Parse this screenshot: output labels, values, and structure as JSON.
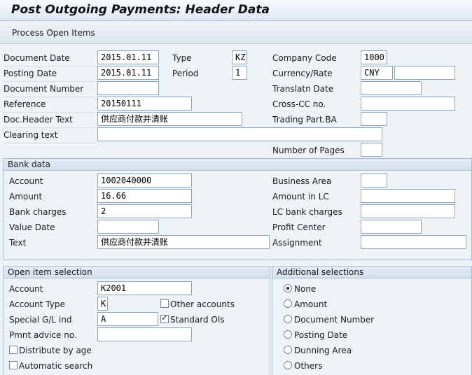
{
  "title": "Post Outgoing Payments: Header Data",
  "toolbar": {
    "process_open_items": "Process Open Items"
  },
  "header": {
    "document_date": {
      "label": "Document Date",
      "value": "2015.01.11"
    },
    "type": {
      "label": "Type",
      "value": "KZ"
    },
    "company_code": {
      "label": "Company Code",
      "value": "1000"
    },
    "posting_date": {
      "label": "Posting Date",
      "value": "2015.01.11"
    },
    "period": {
      "label": "Period",
      "value": "1"
    },
    "currency_rate": {
      "label": "Currency/Rate",
      "currency": "CNY",
      "rate": ""
    },
    "document_number": {
      "label": "Document Number",
      "value": ""
    },
    "translatn_date": {
      "label": "Translatn Date",
      "value": ""
    },
    "reference": {
      "label": "Reference",
      "value": "20150111"
    },
    "cross_cc": {
      "label": "Cross-CC no.",
      "value": ""
    },
    "doc_header_text": {
      "label": "Doc.Header Text",
      "value": "供应商付款并清账"
    },
    "trading_part": {
      "label": "Trading Part.BA",
      "value": ""
    },
    "clearing_text": {
      "label": "Clearing text",
      "value": ""
    },
    "number_of_pages": {
      "label": "Number of Pages",
      "value": ""
    }
  },
  "bank": {
    "title": "Bank data",
    "account": {
      "label": "Account",
      "value": "1002040000"
    },
    "business_area": {
      "label": "Business Area",
      "value": ""
    },
    "amount": {
      "label": "Amount",
      "value": "16.66"
    },
    "amount_lc": {
      "label": "Amount in LC",
      "value": ""
    },
    "bank_charges": {
      "label": "Bank charges",
      "value": "2"
    },
    "lc_bank_charges": {
      "label": "LC bank charges",
      "value": ""
    },
    "value_date": {
      "label": "Value Date",
      "value": ""
    },
    "profit_center": {
      "label": "Profit Center",
      "value": ""
    },
    "text": {
      "label": "Text",
      "value": "供应商付款并清账"
    },
    "assignment": {
      "label": "Assignment",
      "value": ""
    }
  },
  "open_items": {
    "title": "Open item selection",
    "account": {
      "label": "Account",
      "value": "K2001"
    },
    "account_type": {
      "label": "Account Type",
      "value": "K"
    },
    "other_accounts": {
      "label": "Other accounts",
      "checked": false
    },
    "special_gl": {
      "label": "Special G/L ind",
      "value": "A"
    },
    "standard_ois": {
      "label": "Standard OIs",
      "checked": true
    },
    "pmnt_advice": {
      "label": "Pmnt advice no.",
      "value": ""
    },
    "distribute_by_age": {
      "label": "Distribute by age",
      "checked": false
    },
    "automatic_search": {
      "label": "Automatic search",
      "checked": false
    }
  },
  "additional": {
    "title": "Additional selections",
    "options": [
      {
        "label": "None",
        "selected": true
      },
      {
        "label": "Amount",
        "selected": false
      },
      {
        "label": "Document Number",
        "selected": false
      },
      {
        "label": "Posting Date",
        "selected": false
      },
      {
        "label": "Dunning Area",
        "selected": false
      },
      {
        "label": "Others",
        "selected": false
      }
    ]
  }
}
